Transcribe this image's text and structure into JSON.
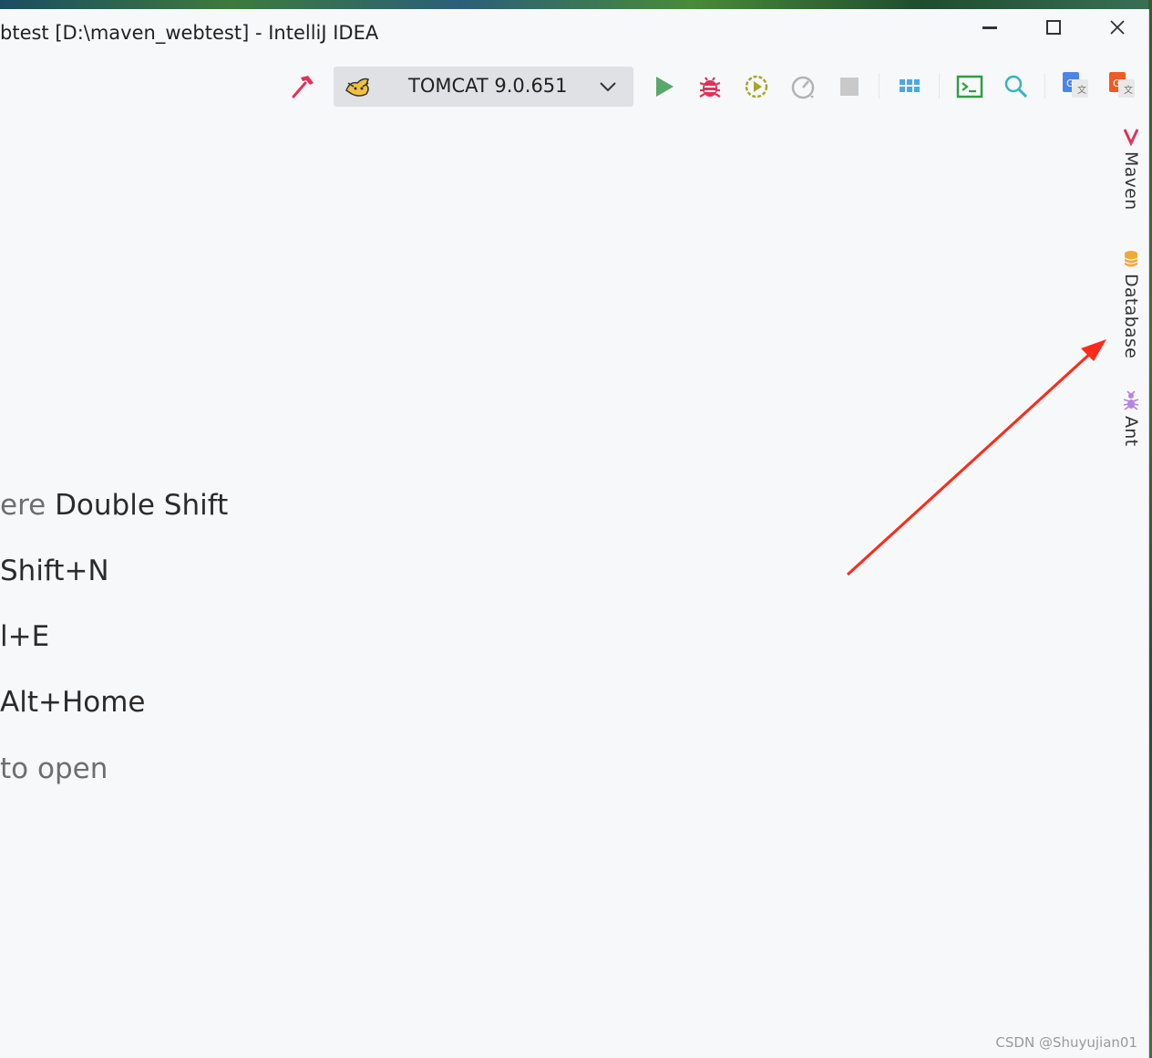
{
  "window": {
    "title": "btest [D:\\maven_webtest] - IntelliJ IDEA"
  },
  "window_controls": [
    "minimize",
    "maximize",
    "close"
  ],
  "toolbar": {
    "run_config_label": "TOMCAT 9.0.651",
    "icons": [
      "hammer-icon",
      "tomcat-icon",
      "run-icon",
      "debug-icon",
      "coverage-icon",
      "profiler-icon",
      "stop-icon",
      "layout-icon",
      "terminal-icon",
      "search-icon",
      "google-translate-icon",
      "google-translate-alt-icon"
    ],
    "colors": {
      "hammer": "#e0325a",
      "run": "#59a869",
      "debug": "#e0325a",
      "coverage": "#a6a52c",
      "terminal": "#2f9e44",
      "search": "#35b2c4",
      "layout": "#4aa8e8"
    }
  },
  "right_sidebar": {
    "tabs": [
      {
        "label": "Maven",
        "icon": "maven-icon",
        "color": "#e0325a"
      },
      {
        "label": "Database",
        "icon": "database-icon",
        "color": "#f2a93b"
      },
      {
        "label": "Ant",
        "icon": "ant-icon",
        "color": "#b784e0"
      }
    ]
  },
  "hints": [
    {
      "muted": "ere ",
      "text": "Double Shift"
    },
    {
      "muted": "",
      "text": "Shift+N"
    },
    {
      "muted": "",
      "text": "l+E"
    },
    {
      "muted": "",
      "text": "Alt+Home"
    },
    {
      "muted": "to open",
      "text": ""
    }
  ],
  "annotation": {
    "type": "arrow",
    "color": "#ff2a1a"
  },
  "watermark": "CSDN @Shuyujian01"
}
